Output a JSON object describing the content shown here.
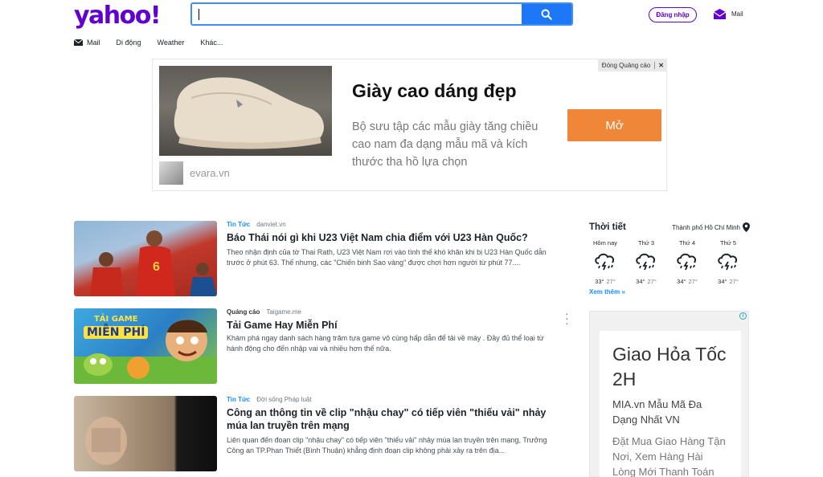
{
  "header": {
    "logo": "yahoo!",
    "search_value": "",
    "signin_label": "Đăng nhập",
    "mail_label": "Mail"
  },
  "nav": {
    "items": [
      "Mail",
      "Di động",
      "Weather",
      "Khác..."
    ]
  },
  "ad_banner": {
    "close_label": "Đóng Quảng cáo",
    "close_x": "✕",
    "title": "Giày cao dáng đẹp",
    "description": "Bộ sưu tập các mẫu giày tăng chiều cao nam đa dạng mẫu mã và kích thước tha hồ lựa chọn",
    "cta": "Mở",
    "domain": "evara.vn"
  },
  "stream": [
    {
      "category": "Tin Tức",
      "source": "danviet.vn",
      "title": "Báo Thái nói gì khi U23 Việt Nam chia điểm với U23 Hàn Quốc?",
      "body": "Theo nhận định của tờ Thai Rath, U23 Việt Nam rơi vào tình thế khó khăn khi bị U23 Hàn Quốc dẫn trước ở phút 63. Thế nhưng, các \"Chiến binh Sao vàng\" được chơi hơn người từ phút 77...."
    },
    {
      "category": "Quảng cáo",
      "source": "Taigame.me",
      "title": "Tải Game Hay Miễn Phí",
      "body": "Khám phá ngay danh sách hàng trăm tựa game vô cùng hấp dẫn để tải về máy . Đầy đủ thể loại từ hành động cho đến nhập vai và nhiều hơn thế nữa.",
      "thumb_text_1": "TẢI GAME",
      "thumb_text_2": "MIỄN PHÍ"
    },
    {
      "category": "Tin Tức",
      "source": "Đời sống Pháp luật",
      "title": "Công an thông tin về clip \"nhậu chay\" có tiếp viên \"thiếu vải\" nhảy múa lan truyền trên mạng",
      "body": "Liên quan đến đoạn clip \"nhậu chay\" có tiếp viên \"thiếu vải\" nhảy múa lan truyền trên mạng, Trưởng Công an TP.Phan Thiết (Bình Thuận) khẳng định đoạn clip không phải xảy ra trên địa..."
    }
  ],
  "weather": {
    "title": "Thời tiết",
    "location": "Thành phố Hồ Chí Minh",
    "days": [
      {
        "day": "Hôm nay",
        "high": "33°",
        "low": "27°",
        "icon": "thunderstorm-icon"
      },
      {
        "day": "Thứ 3",
        "high": "34°",
        "low": "27°",
        "icon": "thunderstorm-icon"
      },
      {
        "day": "Thứ 4",
        "high": "34°",
        "low": "27°",
        "icon": "thunderstorm-icon"
      },
      {
        "day": "Thứ 5",
        "high": "34°",
        "low": "27°",
        "icon": "thunderstorm-icon"
      }
    ],
    "more": "Xem thêm »"
  },
  "right_ad": {
    "info": "i",
    "title": "Giao Hỏa Tốc 2H",
    "subtitle": "MIA.vn Mẫu Mã Đa Dạng Nhất VN",
    "description": "Đặt Mua Giao Hàng Tận Nơi, Xem Hàng Hài Lòng Mới Thanh Toán"
  },
  "colors": {
    "brand": "#6001d2",
    "search_button": "#1e77f6",
    "link": "#188fff",
    "cta": "#f08638"
  }
}
